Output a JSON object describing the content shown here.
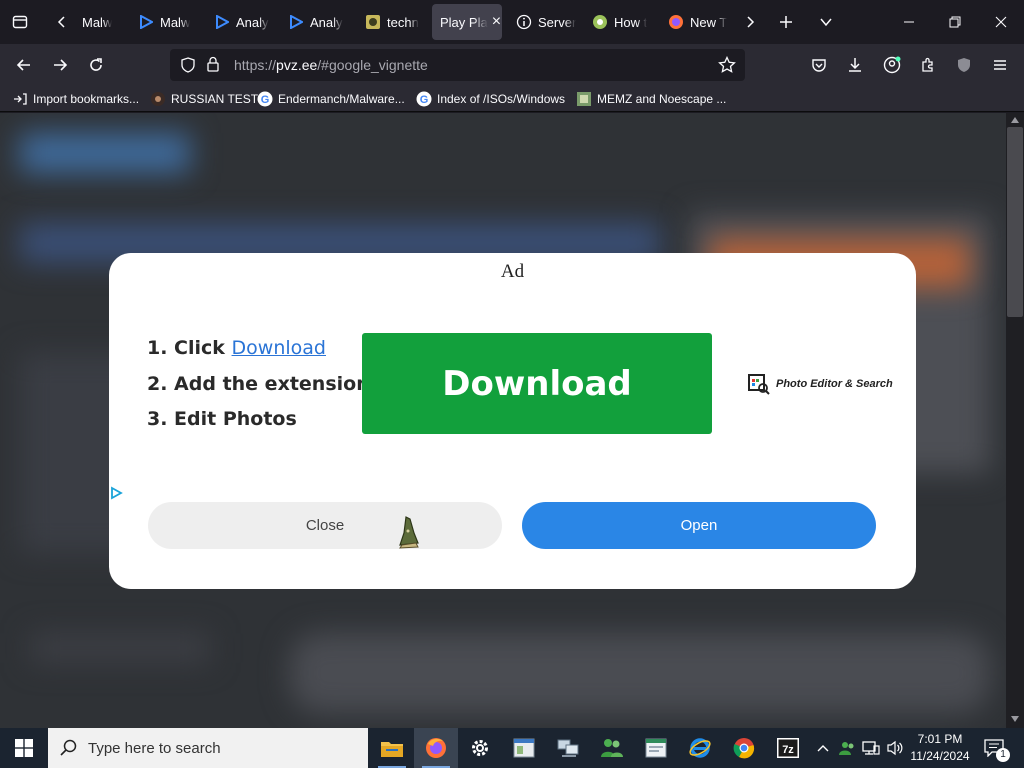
{
  "browser": {
    "tabs": [
      {
        "label": "Malw",
        "icon": "page-icon"
      },
      {
        "label": "Malw",
        "icon": "play-icon"
      },
      {
        "label": "Analy",
        "icon": "play-icon"
      },
      {
        "label": "Analy",
        "icon": "play-icon"
      },
      {
        "label": "techn",
        "icon": "site-icon"
      },
      {
        "label": "Play Pla",
        "icon": "none",
        "active": true
      },
      {
        "label": "Server",
        "icon": "info-icon"
      },
      {
        "label": "How t",
        "icon": "site-icon"
      },
      {
        "label": "New T",
        "icon": "firefox-icon"
      }
    ],
    "url": {
      "prefix": "https://",
      "host": "pvz.ee",
      "rest": "/#google_vignette"
    },
    "bookmarks": [
      {
        "label": "Import bookmarks...",
        "icon": "import-icon"
      },
      {
        "label": "RUSSIAN TEST",
        "icon": "site-icon"
      },
      {
        "label": "Endermanch/Malware...",
        "icon": "google-icon"
      },
      {
        "label": "Index of /ISOs/Windows",
        "icon": "google-icon"
      },
      {
        "label": "MEMZ and Noescape ...",
        "icon": "site-icon"
      }
    ]
  },
  "ad": {
    "label": "Ad",
    "step1_prefix": "1. Click ",
    "step1_link": "Download",
    "step2": "2. Add the extension",
    "step3": "3. Edit Photos",
    "download_button": "Download",
    "logo_text": "Photo Editor & Search",
    "close_button": "Close",
    "open_button": "Open"
  },
  "taskbar": {
    "search_placeholder": "Type here to search",
    "time": "7:01 PM",
    "date": "11/24/2024",
    "notification_count": "1"
  },
  "colors": {
    "download_green": "#12a03c",
    "open_blue": "#2a86e6",
    "link_blue": "#2a74d6"
  }
}
